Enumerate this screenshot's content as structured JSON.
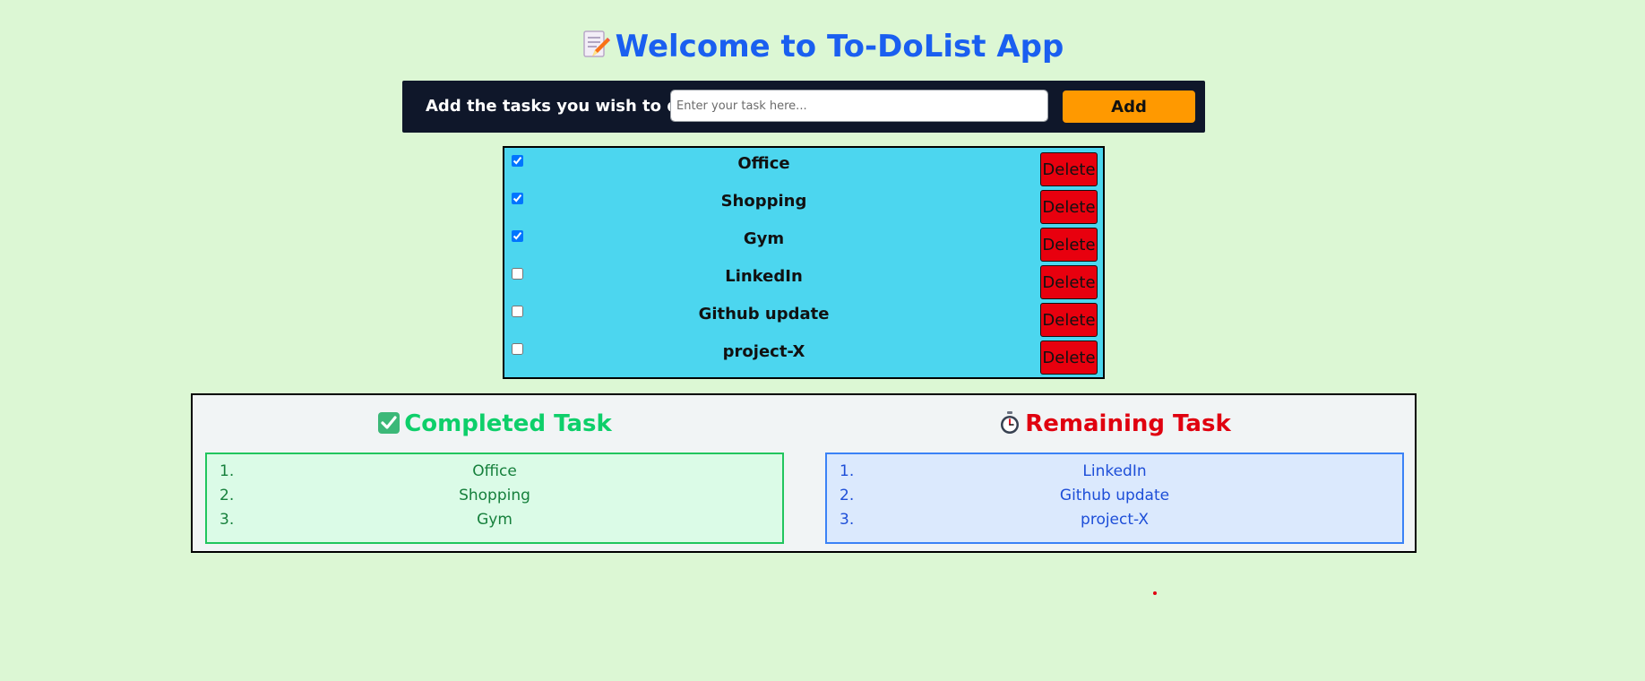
{
  "header": {
    "title": "Welcome to To-DoList App",
    "icon": "memo-pencil-icon"
  },
  "add_bar": {
    "label": "Add the tasks you wish to do :",
    "input_placeholder": "Enter your task here...",
    "input_value": "",
    "add_label": "Add"
  },
  "tasks": [
    {
      "name": "Office",
      "checked": true,
      "delete_label": "Delete"
    },
    {
      "name": "Shopping",
      "checked": true,
      "delete_label": "Delete"
    },
    {
      "name": "Gym",
      "checked": true,
      "delete_label": "Delete"
    },
    {
      "name": "LinkedIn",
      "checked": false,
      "delete_label": "Delete"
    },
    {
      "name": "Github update",
      "checked": false,
      "delete_label": "Delete"
    },
    {
      "name": "project-X",
      "checked": false,
      "delete_label": "Delete"
    }
  ],
  "summary": {
    "completed": {
      "title": "Completed Task",
      "icon": "check-mark-button-icon",
      "items": [
        "Office",
        "Shopping",
        "Gym"
      ]
    },
    "remaining": {
      "title": "Remaining Task",
      "icon": "stopwatch-icon",
      "items": [
        "LinkedIn",
        "Github update",
        "project-X"
      ]
    }
  },
  "colors": {
    "page_bg": "#dcf7d4",
    "title": "#1a5ff0",
    "add_bar_bg": "#0f172a",
    "add_button": "#ff9900",
    "task_list_bg": "#4cd6ef",
    "delete_button": "#e8000e",
    "completed_accent": "#0ecf6a",
    "remaining_accent": "#e0000f"
  }
}
